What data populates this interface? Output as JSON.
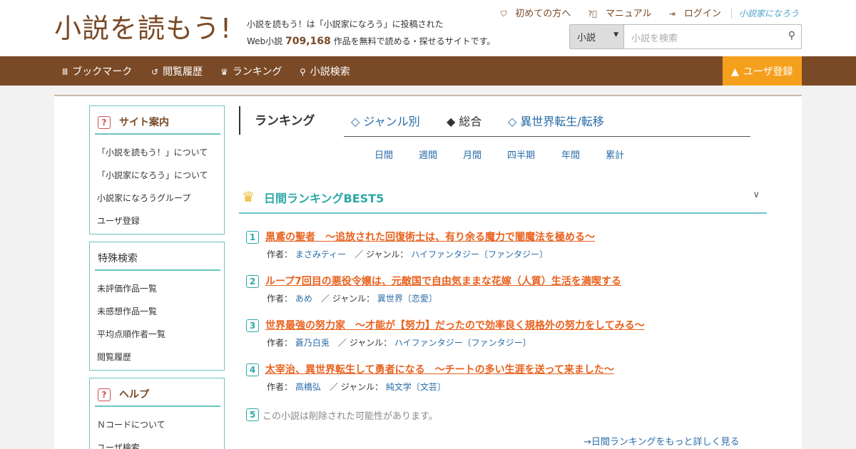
{
  "header": {
    "logo": "小説を読もう!",
    "tagline_line1": "小説を読もう！は「小説家になろう」に投稿された",
    "tagline_prefix": "Web小説",
    "tagline_count": "709,168",
    "tagline_suffix": "作品を無料で読める・探せるサイトです。",
    "links": {
      "beginner": "初めての方へ",
      "manual": "マニュアル",
      "login": "ログイン",
      "narou": "小説家になろう"
    },
    "search": {
      "scope": "小説",
      "placeholder": "小説を検索"
    }
  },
  "nav": {
    "bookmark": "ブックマーク",
    "history": "閲覧履歴",
    "ranking": "ランキング",
    "search": "小説検索",
    "register": "ユーザ登録"
  },
  "sidebar": {
    "guide": {
      "title": "サイト案内",
      "items": [
        "「小説を読もう！」について",
        "「小説家になろう」について",
        "小説家になろうグループ",
        "ユーザ登録"
      ]
    },
    "special": {
      "title": "特殊検索",
      "items": [
        "未評価作品一覧",
        "未感想作品一覧",
        "平均点順作者一覧",
        "閲覧履歴"
      ]
    },
    "help": {
      "title": "ヘルプ",
      "items": [
        "Ｎコードについて",
        "ユーザ検索"
      ]
    }
  },
  "ranking": {
    "heading": "ランキング",
    "tabs": [
      "◇ ジャンル別",
      "◆ 総合",
      "◇ 異世界転生/転移"
    ],
    "periods": [
      "日間",
      "週間",
      "月間",
      "四半期",
      "年間",
      "累計"
    ],
    "best_title": "日間ランキングBEST5",
    "author_label": "作者：",
    "genre_label": "／ ジャンル：",
    "entries": [
      {
        "rank": "1",
        "title": "黒鳶の聖者　～追放された回復術士は、有り余る魔力で闇魔法を極める～",
        "author": "まさみティー",
        "genre": "ハイファンタジー〔ファンタジー〕"
      },
      {
        "rank": "2",
        "title": "ループ7回目の悪役令嬢は、元敵国で自由気ままな花嫁（人質）生活を満喫する",
        "author": "あめ",
        "genre": "異世界〔恋愛〕"
      },
      {
        "rank": "3",
        "title": "世界最強の努力家　～才能が【努力】だったので効率良く規格外の努力をしてみる～",
        "author": "蒼乃白兎",
        "genre": "ハイファンタジー〔ファンタジー〕"
      },
      {
        "rank": "4",
        "title": "太宰治、異世界転生して勇者になる　～チートの多い生涯を送って来ました～",
        "author": "高橋弘",
        "genre": "純文学〔文芸〕"
      }
    ],
    "deleted": {
      "rank": "5",
      "text": "この小説は削除された可能性があります。"
    },
    "more": "→日間ランキングをもっと詳しく見る"
  }
}
